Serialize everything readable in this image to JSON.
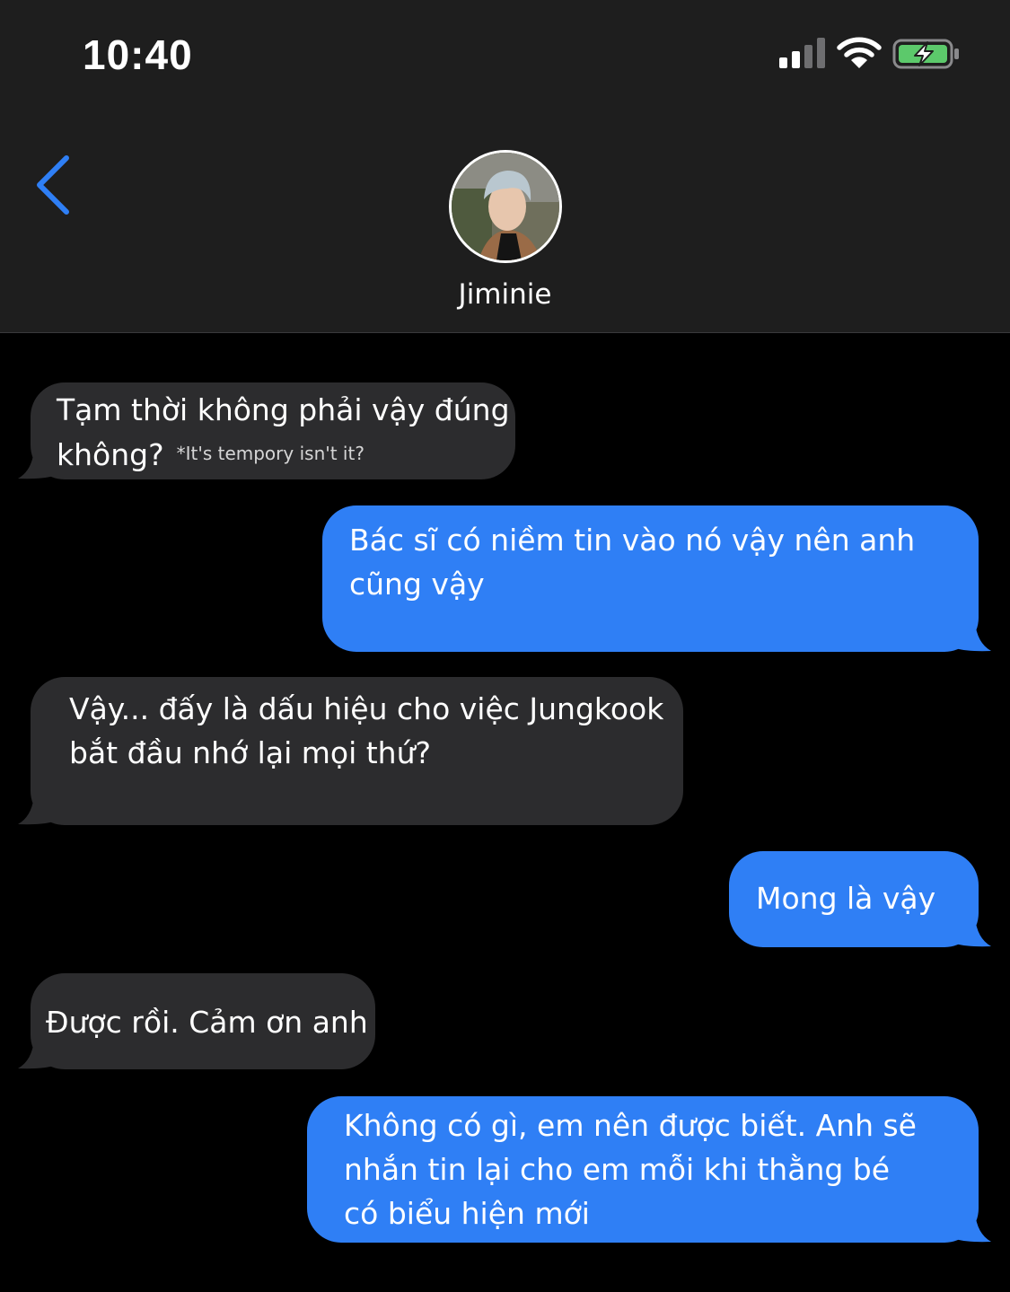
{
  "status_bar": {
    "time": "10:40",
    "icons": [
      "cellular-signal-icon",
      "wifi-icon",
      "battery-charging-icon"
    ]
  },
  "header": {
    "back_icon": "chevron-left-icon",
    "contact_name": "Jiminie"
  },
  "messages": [
    {
      "direction": "incoming",
      "text": "Tạm thời không phải vậy đúng không?",
      "note": "*It's tempory isn't it?"
    },
    {
      "direction": "outgoing",
      "text": "Bác sĩ có niềm tin vào nó vậy nên anh cũng vậy"
    },
    {
      "direction": "incoming",
      "text": "Vậy... đấy là dấu hiệu cho việc Jungkook bắt đầu nhớ lại mọi thứ?"
    },
    {
      "direction": "outgoing",
      "text": "Mong là vậy"
    },
    {
      "direction": "incoming",
      "text": "Được rồi. Cảm ơn anh"
    },
    {
      "direction": "outgoing",
      "text": "Không có gì, em nên được biết. Anh sẽ nhắn tin lại cho em mỗi khi thằng bé có biểu hiện mới"
    }
  ],
  "colors": {
    "header_bg": "#1e1e1e",
    "background": "#000000",
    "incoming_bubble": "#2c2c2e",
    "outgoing_bubble": "#2f7ff5",
    "accent": "#2f7ff5",
    "battery_fill": "#5cc96b"
  }
}
